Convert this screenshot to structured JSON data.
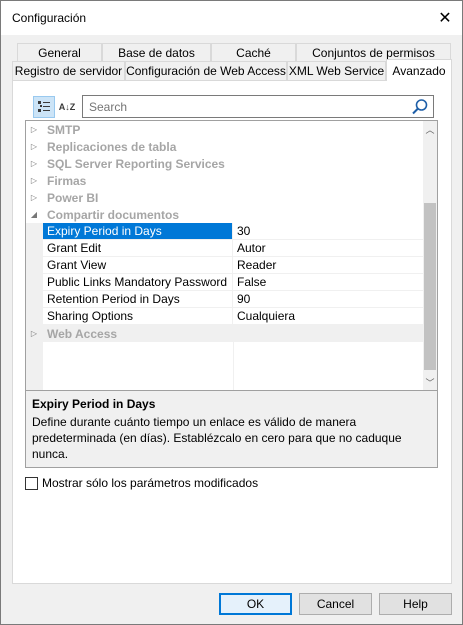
{
  "window": {
    "title": "Configuración",
    "close_glyph": "✕"
  },
  "tabs": {
    "row1": [
      "General",
      "Base de datos",
      "Caché",
      "Conjuntos de permisos"
    ],
    "row2": [
      "Registro de servidor",
      "Configuración de Web Access",
      "XML Web Service",
      "Avanzado"
    ],
    "active": "Avanzado"
  },
  "toolbar": {
    "categorized_icon": "categorized-view-icon",
    "sort_icon": "alphabetical-sort-icon",
    "sort_glyph": "A↓Z",
    "search_placeholder": "Search",
    "search_icon": "search-icon"
  },
  "grid": {
    "categories_top": [
      {
        "label": "SMTP",
        "expander": "▷"
      },
      {
        "label": "Replicaciones de tabla",
        "expander": "▷"
      },
      {
        "label": "SQL Server Reporting Services",
        "expander": "▷"
      },
      {
        "label": "Firmas",
        "expander": "▷"
      },
      {
        "label": "Power BI",
        "expander": "▷"
      },
      {
        "label": "Compartir documentos",
        "expander": "◢"
      }
    ],
    "properties": [
      {
        "name": "Expiry Period in Days",
        "value": "30",
        "selected": true
      },
      {
        "name": "Grant Edit",
        "value": "Autor"
      },
      {
        "name": "Grant View",
        "value": "Reader"
      },
      {
        "name": "Public Links Mandatory Password",
        "value": "False"
      },
      {
        "name": "Retention Period in Days",
        "value": "90"
      },
      {
        "name": "Sharing Options",
        "value": "Cualquiera"
      }
    ],
    "categories_bottom": [
      {
        "label": "Web Access",
        "expander": "▷"
      }
    ],
    "scroll_up_glyph": "︿",
    "scroll_down_glyph": "﹀"
  },
  "description": {
    "title": "Expiry Period in Days",
    "text": "Define durante cuánto tiempo un enlace es válido de manera predeterminada (en días). Establézcalo en cero para que no caduque nunca."
  },
  "show_modified_only": {
    "label": "Mostrar sólo los parámetros modificados",
    "checked": false
  },
  "buttons": {
    "ok": "OK",
    "cancel": "Cancel",
    "help": "Help"
  },
  "colors": {
    "selection": "#0078d7",
    "category_text": "#a6a6a6",
    "default_button_border": "#0078d7"
  }
}
